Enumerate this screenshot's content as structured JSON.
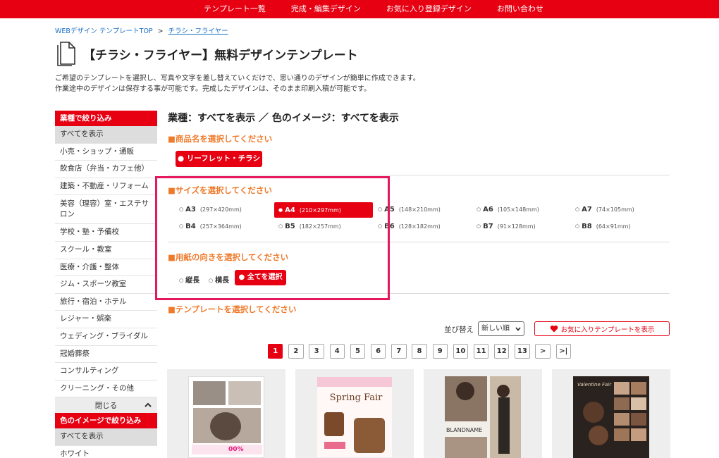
{
  "topnav": {
    "items": [
      "テンプレート一覧",
      "完成・編集デザイン",
      "お気に入り登録デザイン",
      "お問い合わせ"
    ]
  },
  "breadcrumb": {
    "home": "WEBデザイン テンプレートTOP",
    "sep": ">",
    "current": "チラシ・フライヤー"
  },
  "page": {
    "title": "【チラシ・フライヤー】無料デザインテンプレート",
    "desc1": "ご希望のテンプレートを選択し、写真や文字を差し替えていくだけで、思い通りのデザインが簡単に作成できます。",
    "desc2": "作業途中のデザインは保存する事が可能です。完成したデザインは、そのまま印刷入稿が可能です。"
  },
  "sidebar": {
    "industry_title": "業種で絞り込み",
    "industry_items": [
      "すべてを表示",
      "小売・ショップ・通販",
      "飲食店（弁当・カフェ他）",
      "建築・不動産・リフォーム",
      "美容（理容）室・エステサロン",
      "学校・塾・予備校",
      "スクール・教室",
      "医療・介護・整体",
      "ジム・スポーツ教室",
      "旅行・宿泊・ホテル",
      "レジャー・娯楽",
      "ウェディング・ブライダル",
      "冠婚葬祭",
      "コンサルティング",
      "クリーニング・その他"
    ],
    "close_label": "閉じる",
    "color_title": "色のイメージで絞り込み",
    "color_items": [
      "すべてを表示",
      "ホワイト"
    ]
  },
  "main": {
    "heading": "業種：すべてを表示 ／ 色のイメージ：すべてを表示",
    "product_title": "■商品名を選択してください",
    "product_button": "● リーフレット・チラシ",
    "size_title": "■サイズを選択してください",
    "sizes": [
      {
        "name": "A3",
        "dim": "(297×420mm)",
        "selected": false
      },
      {
        "name": "A4",
        "dim": "(210×297mm)",
        "selected": true
      },
      {
        "name": "A5",
        "dim": "(148×210mm)",
        "selected": false
      },
      {
        "name": "A6",
        "dim": "(105×148mm)",
        "selected": false
      },
      {
        "name": "A7",
        "dim": "(74×105mm)",
        "selected": false
      },
      {
        "name": "B4",
        "dim": "(257×364mm)",
        "selected": false
      },
      {
        "name": "B5",
        "dim": "(182×257mm)",
        "selected": false
      },
      {
        "name": "B6",
        "dim": "(128×182mm)",
        "selected": false
      },
      {
        "name": "B7",
        "dim": "(91×128mm)",
        "selected": false
      },
      {
        "name": "B8",
        "dim": "(64×91mm)",
        "selected": false
      }
    ],
    "orient_title": "■用紙の向きを選択してください",
    "orient_portrait": "縦長",
    "orient_landscape": "横長",
    "orient_all": "● 全てを選択",
    "template_title": "■テンプレートを選択してください",
    "sort_label": "並び替え",
    "sort_value": "新しい順",
    "fav_button": "お気に入りテンプレートを表示",
    "pages": [
      "1",
      "2",
      "3",
      "4",
      "5",
      "6",
      "7",
      "8",
      "9",
      "10",
      "11",
      "12",
      "13",
      ">",
      ">|"
    ],
    "current_page": "1",
    "thumb_texts": {
      "spring": "Spring Fair",
      "brand": "BLANDNAME",
      "percent": "00%",
      "valentine": "Valentine Fair"
    }
  },
  "colors": {
    "brand_red": "#e60012",
    "section_orange": "#ee7a2a",
    "highlight_pink": "#e5185f"
  }
}
